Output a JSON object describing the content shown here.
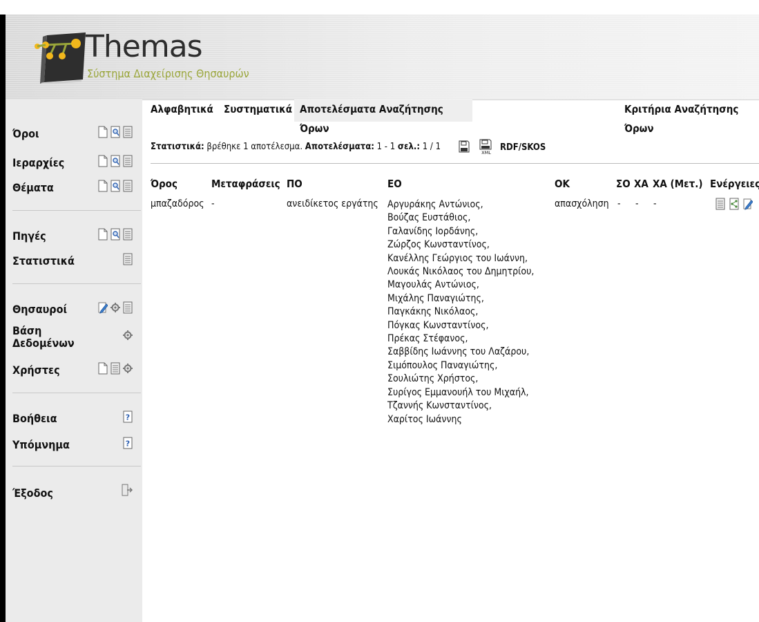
{
  "app": {
    "title": "Themas",
    "subtitle": "Σύστημα Διαχείρισης Θησαυρών"
  },
  "tabs": [
    {
      "label": "Αλφαβητικά"
    },
    {
      "label": "Συστηματικά"
    },
    {
      "label": "Αποτελέσματα Αναζήτησης Όρων",
      "active": true
    },
    {
      "label": "Κριτήρια Αναζήτησης Όρων"
    }
  ],
  "sidebar": {
    "items": [
      {
        "label": "Όροι",
        "icons": [
          "new-document-icon",
          "search-document-icon",
          "list-document-icon"
        ]
      },
      {
        "label": "Ιεραρχίες",
        "icons": [
          "new-document-icon",
          "search-document-icon",
          "list-document-icon"
        ]
      },
      {
        "label": "Θέματα",
        "icons": [
          "new-document-icon",
          "search-document-icon",
          "list-document-icon"
        ]
      },
      {
        "label": "Πηγές",
        "icons": [
          "new-document-icon",
          "search-document-icon",
          "list-document-icon"
        ]
      },
      {
        "label": "Στατιστικά",
        "icons": [
          "list-document-icon"
        ]
      },
      {
        "label": "Θησαυροί",
        "icons": [
          "edit-icon",
          "gear-icon",
          "list-document-icon"
        ]
      },
      {
        "label": "Βάση Δεδομένων",
        "icons": [
          "gear-icon"
        ]
      },
      {
        "label": "Χρήστες",
        "icons": [
          "new-document-icon",
          "list-document-icon",
          "gear-icon"
        ]
      },
      {
        "label": "Βοήθεια",
        "icons": [
          "help-icon"
        ]
      },
      {
        "label": "Υπόμνημα",
        "icons": [
          "help-icon"
        ]
      },
      {
        "label": "Έξοδος",
        "icons": [
          "exit-icon"
        ]
      }
    ]
  },
  "stats": {
    "stats_label": "Στατιστικά:",
    "stats_value": "βρέθηκε 1 αποτέλεσμα.",
    "results_label": "Αποτελέσματα:",
    "results_value": "1 - 1",
    "page_label": "σελ.:",
    "page_value": "1 / 1",
    "export_label": "RDF/SKOS"
  },
  "table": {
    "headers": [
      "Όρος",
      "Μεταφράσεις",
      "ΠΟ",
      "ΕΟ",
      "ΟΚ",
      "ΣΟ",
      "ΧΑ",
      "ΧΑ (Μετ.)",
      "Ενέργειες"
    ],
    "row": {
      "term": "μπαζαδόρος",
      "translations": "-",
      "po": "ανειδίκετος εργάτης",
      "eo": [
        "Αργυράκης Αντώνιος,",
        "Βούζας Ευστάθιος,",
        "Γαλανίδης Ιορδάνης,",
        "Ζώρζος Κωνσταντίνος,",
        "Κανέλλης Γεώργιος του Ιωάννη,",
        "Λουκάς Νικόλαος του Δημητρίου,",
        "Μαγουλάς Αντώνιος,",
        "Μιχάλης Παναγιώτης,",
        "Παγκάκης Νικόλαος,",
        "Πόγκας Κωνσταντίνος,",
        "Πρέκας Στέφανος,",
        "Σαββίδης Ιωάννης του Λαζάρου,",
        "Σιμόπουλος Παναγιώτης,",
        "Σουλιώτης Χρήστος,",
        "Συρίγος Εμμανουήλ του Μιχαήλ,",
        "Τζαννής Κωνσταντίνος,",
        "Χαρίτος Ιωάννης"
      ],
      "ok": "απασχόληση",
      "so": "-",
      "xa": "-",
      "xa_met": "-"
    }
  }
}
